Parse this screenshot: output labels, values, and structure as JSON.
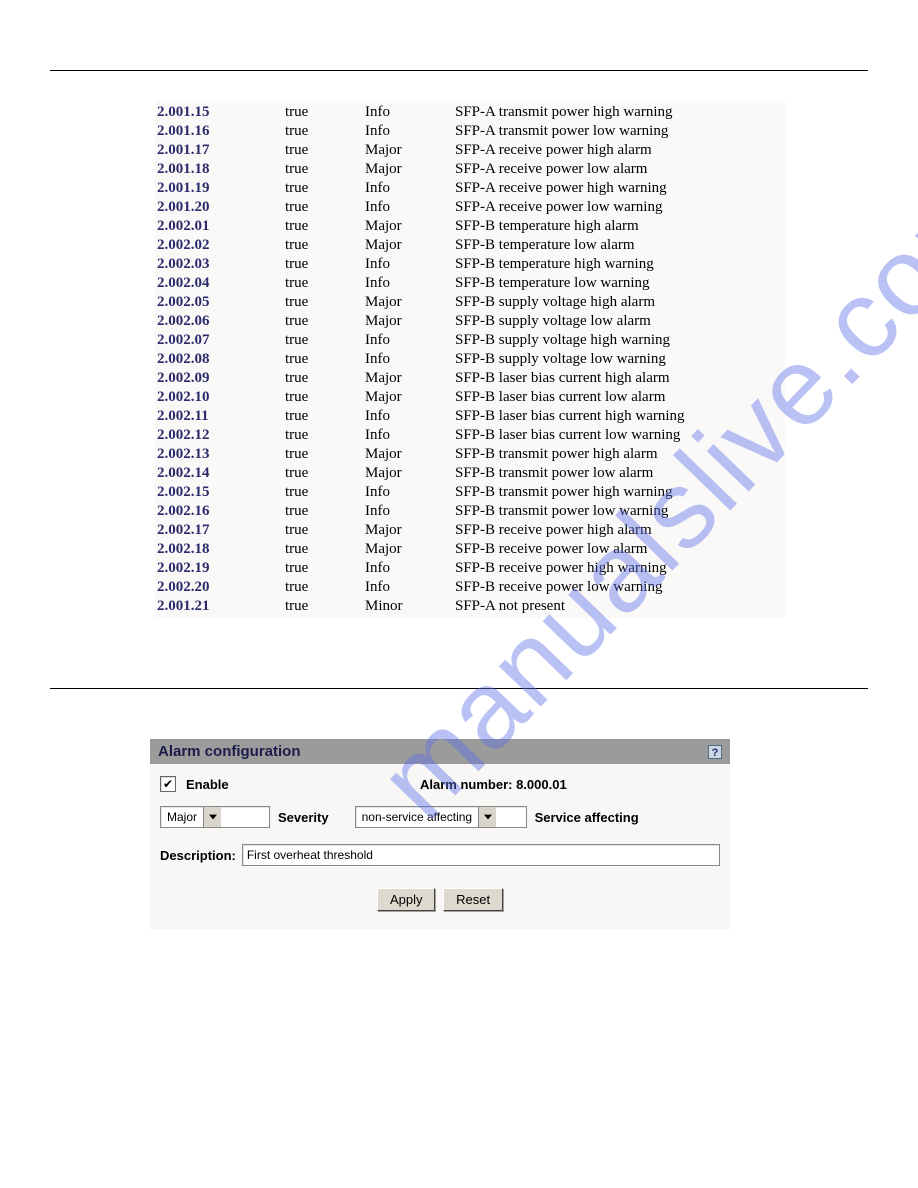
{
  "watermark": "manualslive.com",
  "alarm_rows": [
    {
      "id": "2.001.15",
      "enable": "true",
      "severity": "Info",
      "name": "SFP-A transmit power high warning"
    },
    {
      "id": "2.001.16",
      "enable": "true",
      "severity": "Info",
      "name": "SFP-A transmit power low warning"
    },
    {
      "id": "2.001.17",
      "enable": "true",
      "severity": "Major",
      "name": "SFP-A receive power high alarm"
    },
    {
      "id": "2.001.18",
      "enable": "true",
      "severity": "Major",
      "name": "SFP-A receive power low alarm"
    },
    {
      "id": "2.001.19",
      "enable": "true",
      "severity": "Info",
      "name": "SFP-A receive power high warning"
    },
    {
      "id": "2.001.20",
      "enable": "true",
      "severity": "Info",
      "name": "SFP-A receive power low warning"
    },
    {
      "id": "2.002.01",
      "enable": "true",
      "severity": "Major",
      "name": "SFP-B temperature high alarm"
    },
    {
      "id": "2.002.02",
      "enable": "true",
      "severity": "Major",
      "name": "SFP-B temperature low alarm"
    },
    {
      "id": "2.002.03",
      "enable": "true",
      "severity": "Info",
      "name": "SFP-B temperature high warning"
    },
    {
      "id": "2.002.04",
      "enable": "true",
      "severity": "Info",
      "name": "SFP-B temperature low warning"
    },
    {
      "id": "2.002.05",
      "enable": "true",
      "severity": "Major",
      "name": "SFP-B supply voltage high alarm"
    },
    {
      "id": "2.002.06",
      "enable": "true",
      "severity": "Major",
      "name": "SFP-B supply voltage low alarm"
    },
    {
      "id": "2.002.07",
      "enable": "true",
      "severity": "Info",
      "name": "SFP-B supply voltage high warning"
    },
    {
      "id": "2.002.08",
      "enable": "true",
      "severity": "Info",
      "name": "SFP-B supply voltage low warning"
    },
    {
      "id": "2.002.09",
      "enable": "true",
      "severity": "Major",
      "name": "SFP-B laser bias current high alarm"
    },
    {
      "id": "2.002.10",
      "enable": "true",
      "severity": "Major",
      "name": "SFP-B laser bias current low alarm"
    },
    {
      "id": "2.002.11",
      "enable": "true",
      "severity": "Info",
      "name": "SFP-B laser bias current high warning"
    },
    {
      "id": "2.002.12",
      "enable": "true",
      "severity": "Info",
      "name": "SFP-B laser bias current low warning"
    },
    {
      "id": "2.002.13",
      "enable": "true",
      "severity": "Major",
      "name": "SFP-B transmit power high alarm"
    },
    {
      "id": "2.002.14",
      "enable": "true",
      "severity": "Major",
      "name": "SFP-B transmit power low alarm"
    },
    {
      "id": "2.002.15",
      "enable": "true",
      "severity": "Info",
      "name": "SFP-B transmit power high warning"
    },
    {
      "id": "2.002.16",
      "enable": "true",
      "severity": "Info",
      "name": "SFP-B transmit power low warning"
    },
    {
      "id": "2.002.17",
      "enable": "true",
      "severity": "Major",
      "name": "SFP-B receive power high alarm"
    },
    {
      "id": "2.002.18",
      "enable": "true",
      "severity": "Major",
      "name": "SFP-B receive power low alarm"
    },
    {
      "id": "2.002.19",
      "enable": "true",
      "severity": "Info",
      "name": "SFP-B receive power high warning"
    },
    {
      "id": "2.002.20",
      "enable": "true",
      "severity": "Info",
      "name": "SFP-B receive power low warning"
    },
    {
      "id": "2.001.21",
      "enable": "true",
      "severity": "Minor",
      "name": "SFP-A not present"
    }
  ],
  "panel": {
    "title": "Alarm configuration",
    "help": "?",
    "enable_checked": "✔",
    "enable_label": "Enable",
    "alarm_number_label": "Alarm number: 8.000.01",
    "severity_value": "Major",
    "severity_label": "Severity",
    "sa_value": "non-service affecting",
    "sa_label": "Service affecting",
    "description_label": "Description:",
    "description_value": "First overheat threshold",
    "apply": "Apply",
    "reset": "Reset"
  }
}
